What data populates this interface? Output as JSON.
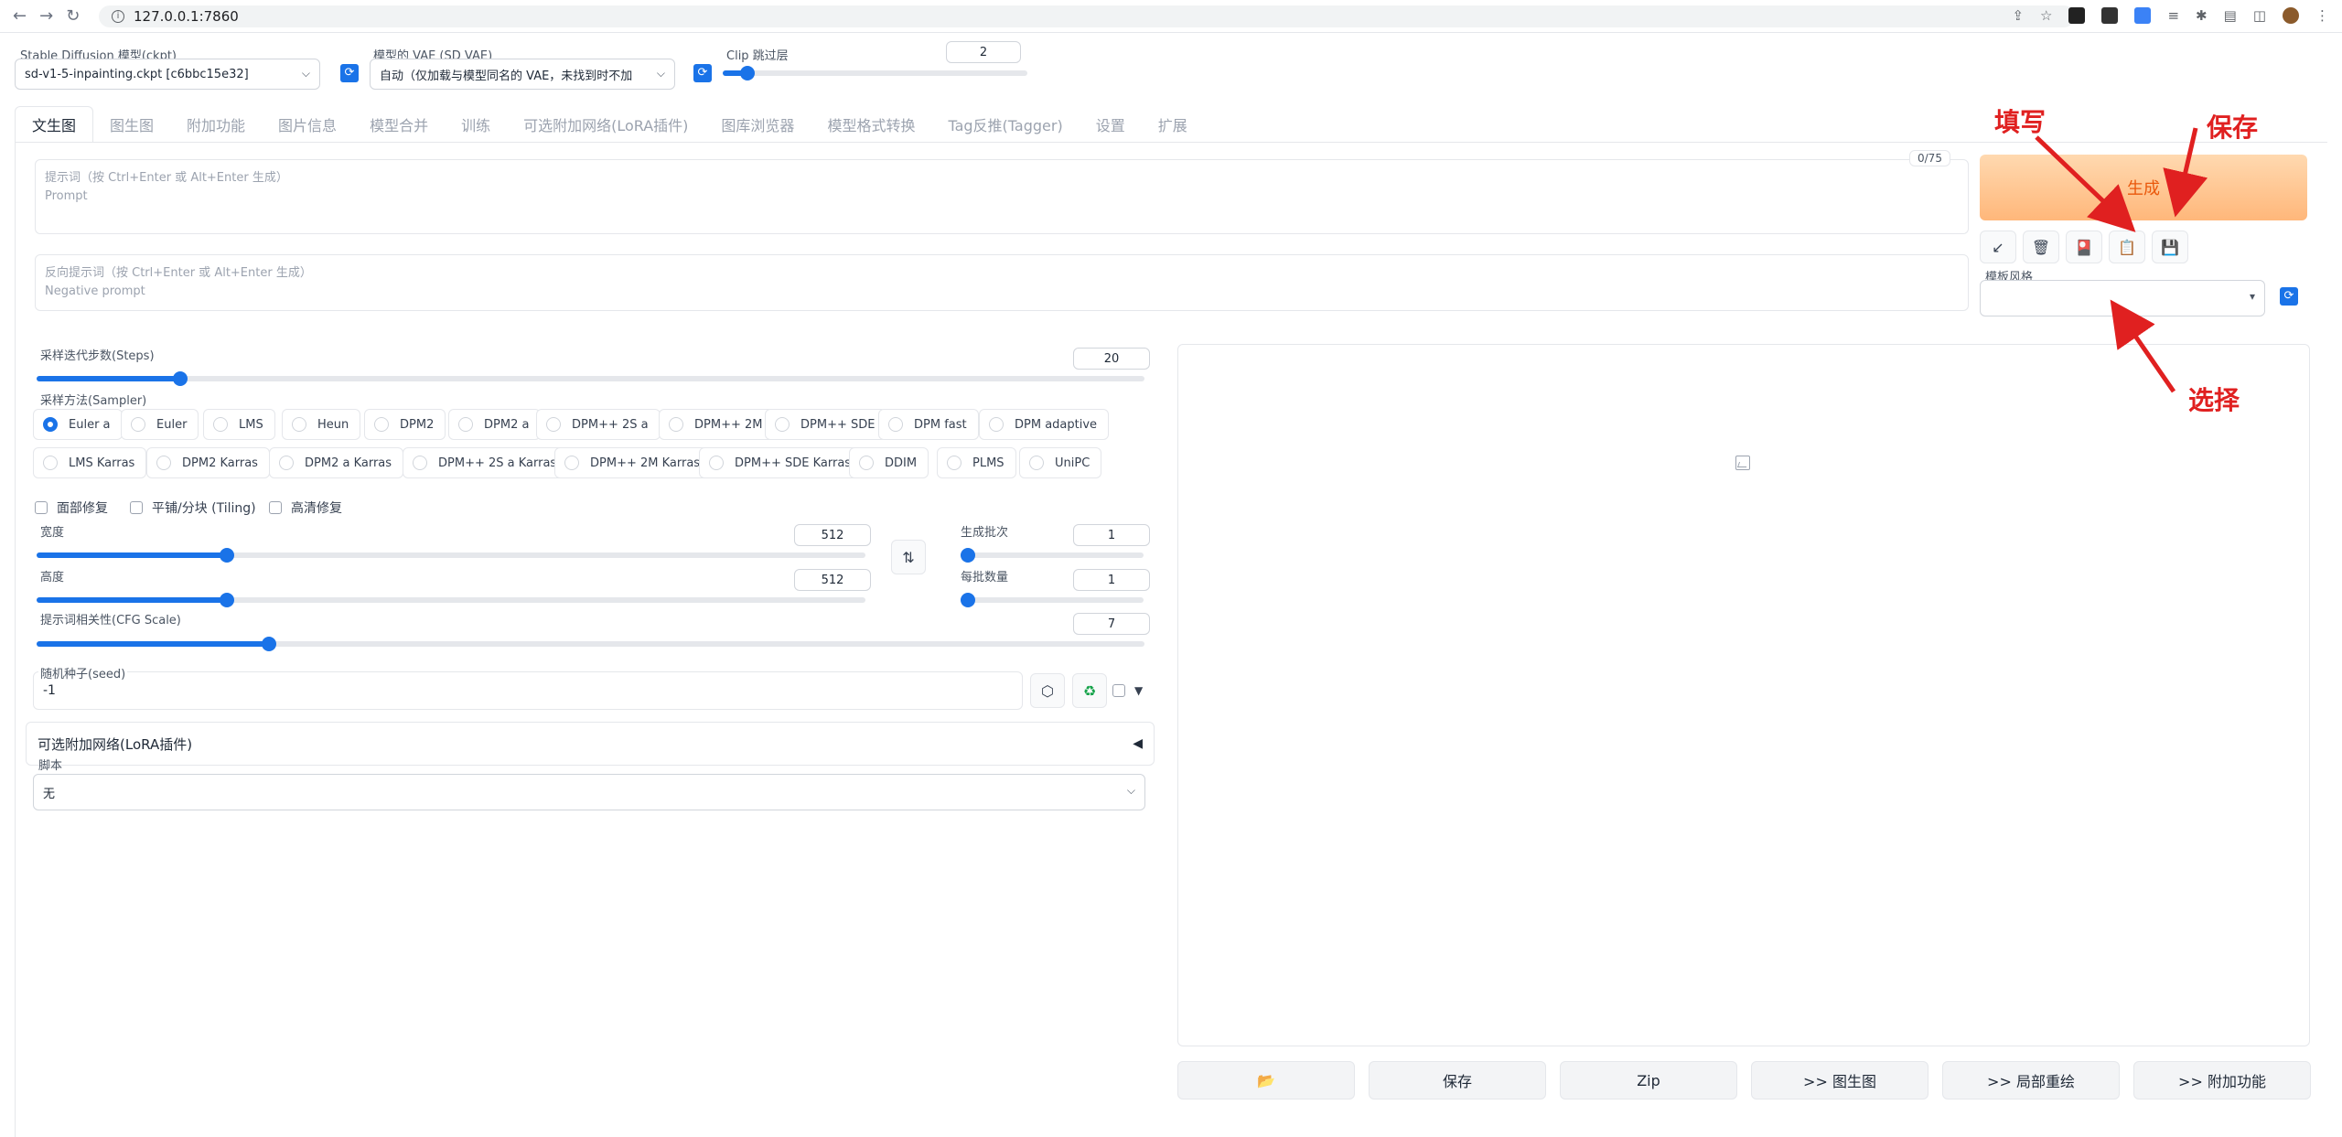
{
  "browser": {
    "url": "127.0.0.1:7860"
  },
  "top": {
    "model_label": "Stable Diffusion 模型(ckpt)",
    "model_value": "sd-v1-5-inpainting.ckpt [c6bbc15e32]",
    "vae_label": "模型的 VAE (SD VAE)",
    "vae_value": "自动（仅加载与模型同名的 VAE，未找到时不加",
    "clip_label": "Clip 跳过层",
    "clip_value": "2",
    "clip_fraction": 0.08
  },
  "tabs": [
    "文生图",
    "图生图",
    "附加功能",
    "图片信息",
    "模型合并",
    "训练",
    "可选附加网络(LoRA插件)",
    "图库浏览器",
    "模型格式转换",
    "Tag反推(Tagger)",
    "设置",
    "扩展"
  ],
  "prompt": {
    "placeholder_line1": "提示词（按 Ctrl+Enter 或 Alt+Enter 生成）",
    "placeholder_line2": "Prompt",
    "counter": "0/75"
  },
  "negative": {
    "placeholder_line1": "反向提示词（按 Ctrl+Enter 或 Alt+Enter 生成）",
    "placeholder_line2": "Negative prompt"
  },
  "generate": {
    "label": "生成",
    "tools": [
      "↙",
      "🗑",
      "🎴",
      "📋",
      "💾"
    ],
    "style_label": "模板风格"
  },
  "steps": {
    "label": "采样迭代步数(Steps)",
    "value": "20",
    "fraction": 0.13
  },
  "sampler": {
    "label": "采样方法(Sampler)",
    "row1": [
      "Euler a",
      "Euler",
      "LMS",
      "Heun",
      "DPM2",
      "DPM2 a",
      "DPM++ 2S a",
      "DPM++ 2M",
      "DPM++ SDE",
      "DPM fast",
      "DPM adaptive"
    ],
    "row2": [
      "LMS Karras",
      "DPM2 Karras",
      "DPM2 a Karras",
      "DPM++ 2S a Karras",
      "DPM++ 2M Karras",
      "DPM++ SDE Karras",
      "DDIM",
      "PLMS",
      "UniPC"
    ],
    "selected": "Euler a"
  },
  "checks": [
    "面部修复",
    "平铺/分块 (Tiling)",
    "高清修复"
  ],
  "width": {
    "label": "宽度",
    "value": "512",
    "fraction": 0.23
  },
  "height": {
    "label": "高度",
    "value": "512",
    "fraction": 0.23
  },
  "batch_count": {
    "label": "生成批次",
    "value": "1",
    "fraction": 0.0
  },
  "batch_size": {
    "label": "每批数量",
    "value": "1",
    "fraction": 0.0
  },
  "cfg": {
    "label": "提示词相关性(CFG Scale)",
    "value": "7",
    "fraction": 0.21
  },
  "seed": {
    "label": "随机种子(seed)",
    "value": "-1"
  },
  "lora": {
    "label": "可选附加网络(LoRA插件)",
    "arrow": "◀"
  },
  "script": {
    "label": "脚本",
    "value": "无"
  },
  "bottom_buttons": [
    "📂",
    "保存",
    "Zip",
    ">> 图生图",
    ">> 局部重绘",
    ">> 附加功能"
  ],
  "annotations": {
    "fill": "填写",
    "save": "保存",
    "select": "选择"
  },
  "colors": {
    "accent": "#1a73e8",
    "generate_text": "#ea580c",
    "annotation": "#e02020"
  }
}
